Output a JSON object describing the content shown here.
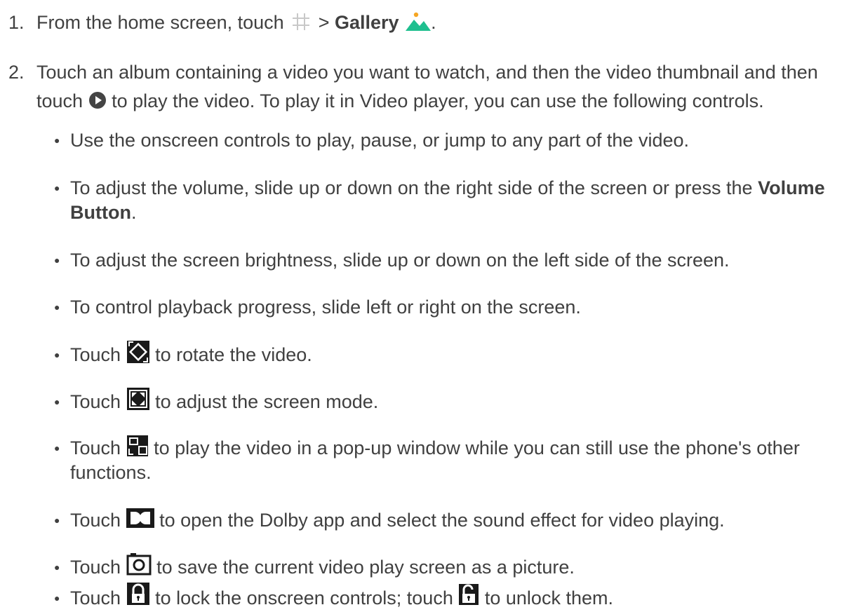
{
  "steps": [
    {
      "number": "1.",
      "pre": "From the home screen, touch",
      "separator": ">",
      "bold": "Gallery",
      "end": ".",
      "icons": [
        "apps-grid-icon",
        "gallery-icon"
      ]
    },
    {
      "number": "2.",
      "line1": "Touch an album containing a video you want to watch, and then the video thumbnail and then",
      "line2_pre": "touch",
      "line2_post": "to play the video. To play it in Video player, you can use the following controls.",
      "icons": [
        "play-icon"
      ]
    }
  ],
  "bullets": [
    {
      "text": "Use the onscreen controls to play, pause, or jump to any part of the video."
    },
    {
      "line1_pre": "To adjust the volume, slide up or down on the right side of the screen or press the",
      "line1_bold": "Volume",
      "line2_bold": "Button",
      "line2_end": "."
    },
    {
      "text": "To adjust the screen brightness, slide up or down on the left side of the screen."
    },
    {
      "text": "To control playback progress, slide left or right on the screen."
    },
    {
      "pre": "Touch",
      "post": "to rotate the video.",
      "icon": "rotate-icon"
    },
    {
      "pre": "Touch",
      "post": "to adjust the screen mode.",
      "icon": "screen-mode-icon"
    },
    {
      "pre": "Touch",
      "post": "to play the video in a pop-up window while you can still use the phone's other",
      "line2": "functions.",
      "icon": "popup-window-icon"
    },
    {
      "pre": "Touch",
      "post": "to open the Dolby app and select the sound effect for video playing.",
      "icon": "dolby-icon"
    },
    {
      "pre": "Touch",
      "post": "to save the current video play screen as a picture.",
      "icon": "capture-icon"
    },
    {
      "pre": "Touch",
      "mid": "to lock the onscreen controls; touch",
      "post": "to unlock them.",
      "icons": [
        "lock-icon",
        "unlock-icon"
      ]
    }
  ],
  "bullet_char": "●",
  "colors": {
    "text": "#404040",
    "gallery_green": "#1fbf8f",
    "icon_dark": "#1a1a1a",
    "grid_gray": "#c8c8c8"
  }
}
